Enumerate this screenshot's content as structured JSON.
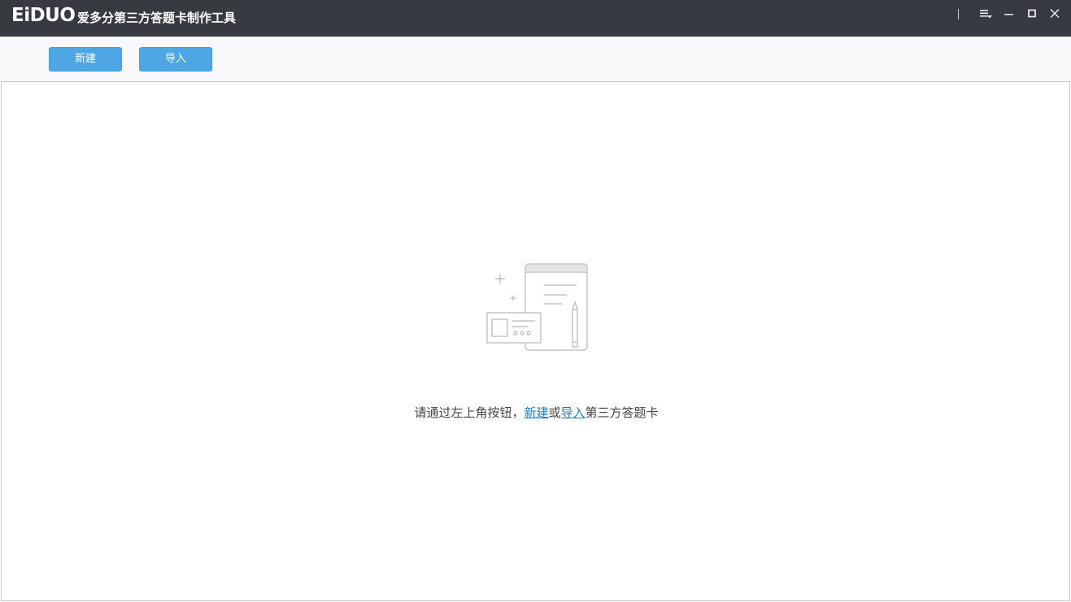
{
  "titlebar": {
    "logo_text": "EiDUO",
    "app_title": "爱多分第三方答题卡制作工具"
  },
  "window_controls": {
    "icons": [
      "menu-icon",
      "minimize-icon",
      "maximize-icon",
      "close-icon"
    ]
  },
  "toolbar": {
    "new_label": "新建",
    "import_label": "导入"
  },
  "empty_state": {
    "text_before": "请通过左上角按钮，",
    "new_link": "新建",
    "text_or": "或",
    "import_link": "导入",
    "text_after": "第三方答题卡"
  },
  "colors": {
    "titlebar_bg": "#383a42",
    "button_bg": "#4fa6e4",
    "link": "#1a7fd0",
    "toolbar_bg": "#f8f8fa"
  }
}
